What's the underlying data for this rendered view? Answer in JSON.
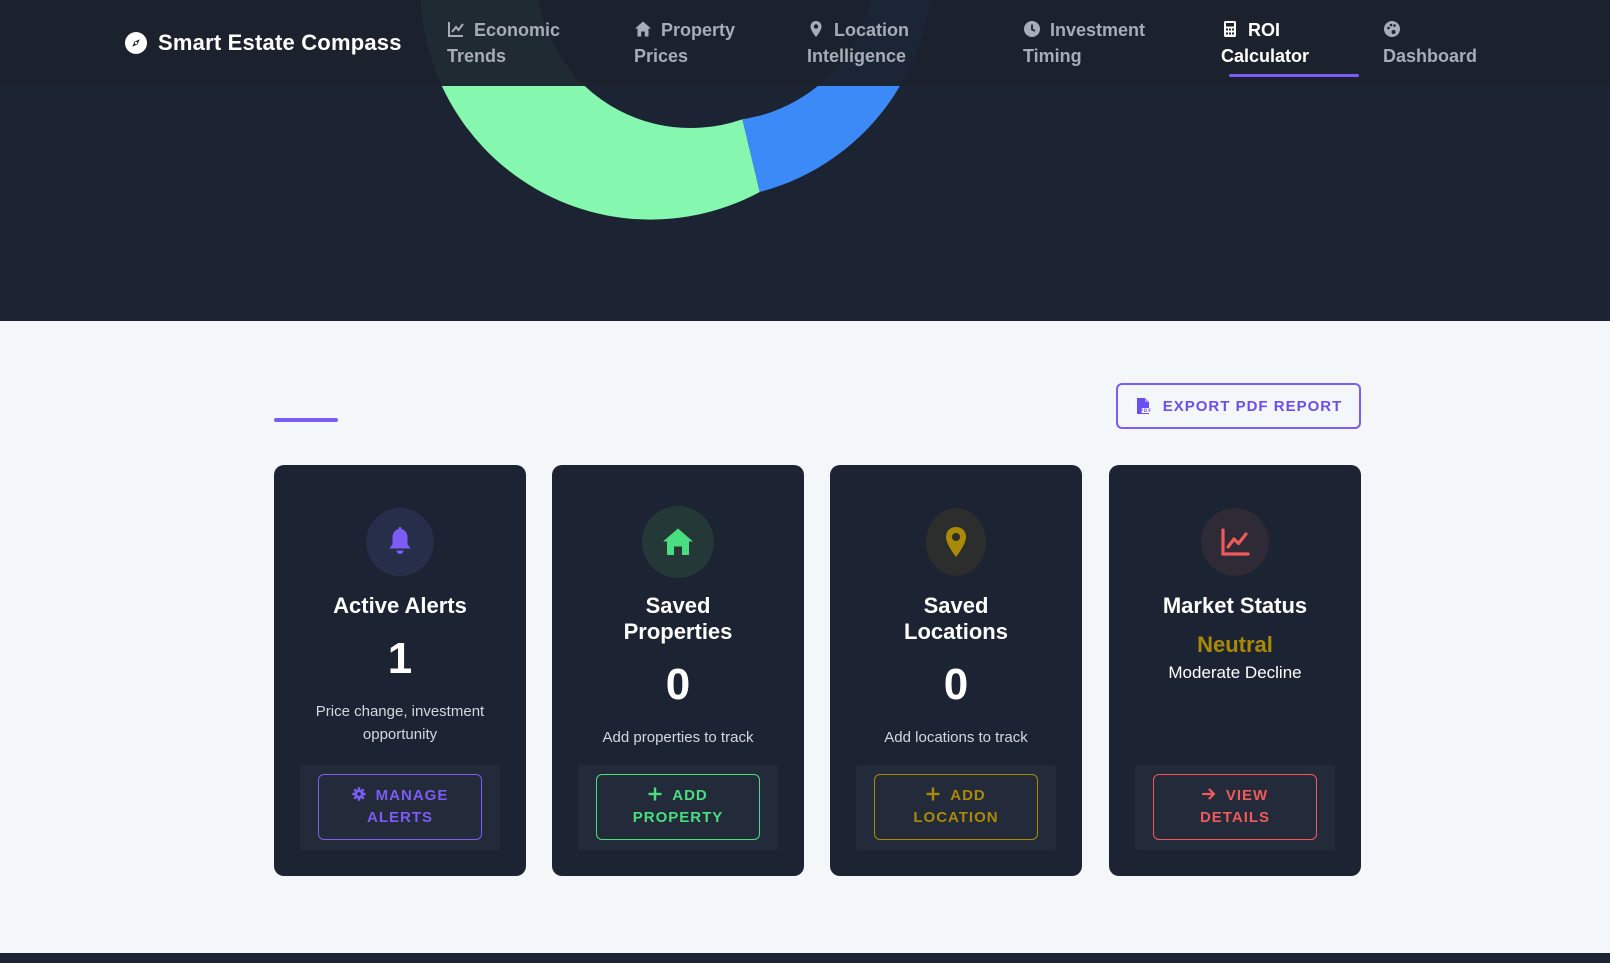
{
  "brand": {
    "name": "Smart Estate Compass",
    "icon": "compass-icon"
  },
  "nav": {
    "items": [
      {
        "line1": "Economic",
        "line2": "Trends",
        "icon": "chart-line-icon",
        "active": false
      },
      {
        "line1": "Property",
        "line2": "Prices",
        "icon": "home-icon",
        "active": false
      },
      {
        "line1": "Location",
        "line2": "Intelligence",
        "icon": "map-pin-icon",
        "active": false
      },
      {
        "line1": "Investment",
        "line2": "Timing",
        "icon": "clock-icon",
        "active": false
      },
      {
        "line1": "ROI",
        "line2": "Calculator",
        "icon": "calculator-icon",
        "active": true
      },
      {
        "line1": "",
        "line2": "Dashboard",
        "icon": "palette-icon",
        "active": false
      }
    ]
  },
  "export": {
    "label": "EXPORT PDF REPORT",
    "icon": "file-pdf-icon"
  },
  "cards": [
    {
      "title": "Active Alerts",
      "value": "1",
      "description": "Price change, investment opportunity",
      "button_line1": "MANAGE",
      "button_line2": "ALERTS",
      "icon": "bell-icon",
      "button_icon": "gear-icon",
      "color": "#7b5cf5"
    },
    {
      "title_line1": "Saved",
      "title_line2": "Properties",
      "value": "0",
      "description": "Add properties to track",
      "button_line1": "ADD",
      "button_line2": "PROPERTY",
      "icon": "home-icon",
      "button_icon": "plus-icon",
      "color": "#4ade80"
    },
    {
      "title_line1": "Saved",
      "title_line2": "Locations",
      "value": "0",
      "description": "Add locations to track",
      "button_line1": "ADD",
      "button_line2": "LOCATION",
      "icon": "map-pin-icon",
      "button_icon": "plus-icon",
      "color": "#a98a06"
    },
    {
      "title": "Market Status",
      "status": "Neutral",
      "status_detail": "Moderate Decline",
      "button_line1": "VIEW",
      "button_line2": "DETAILS",
      "icon": "chart-line-icon",
      "button_icon": "arrow-right-icon",
      "color": "#f05a5a"
    }
  ],
  "colors": {
    "accent": "#7b5cf5",
    "green": "#4ade80",
    "gold": "#a98a06",
    "red": "#f05a5a",
    "card_bg": "#1c2333",
    "page_bg": "#f4f7fa",
    "donut_green": "#86f7ae",
    "donut_blue": "#3b8af7"
  }
}
